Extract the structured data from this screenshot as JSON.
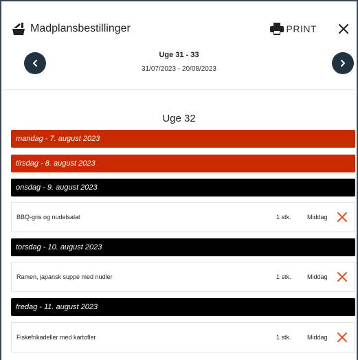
{
  "header": {
    "title": "Madplansbestillinger",
    "print_label": "PRINT",
    "icons": {
      "app": "basket-icon",
      "print": "printer-icon",
      "close": "close-icon"
    }
  },
  "nav": {
    "range_title": "Uge 31 - 33",
    "range_dates": "31/07/2023 - 20/08/2023",
    "prev_icon": "chevron-left-icon",
    "next_icon": "chevron-right-icon"
  },
  "week": {
    "title": "Uge 32"
  },
  "days": [
    {
      "label": "mandag - 7. august 2023",
      "color": "#c92a00"
    },
    {
      "label": "tirsdag - 8. august 2023",
      "color": "#c92a00"
    },
    {
      "label": "onsdag - 9. august 2023",
      "color": "#000000"
    },
    {
      "label": "torsdag - 10. august 2023",
      "color": "#000000"
    },
    {
      "label": "fredag - 11. august 2023",
      "color": "#000000"
    }
  ],
  "orders": [
    {
      "name": "BBQ-gris og nudelsalat",
      "qty": "1 stk.",
      "meal": "Middag"
    },
    {
      "name": "Ramen, japansk suppe med nudler",
      "qty": "1 stk.",
      "meal": "Middag"
    },
    {
      "name": "Fiskefrikadeller med kartofler",
      "qty": "1 stk.",
      "meal": "Middag"
    }
  ],
  "colors": {
    "accent": "#e8531c",
    "nav_button": "#213340",
    "busy_day": "#c92a00",
    "day": "#000000"
  }
}
